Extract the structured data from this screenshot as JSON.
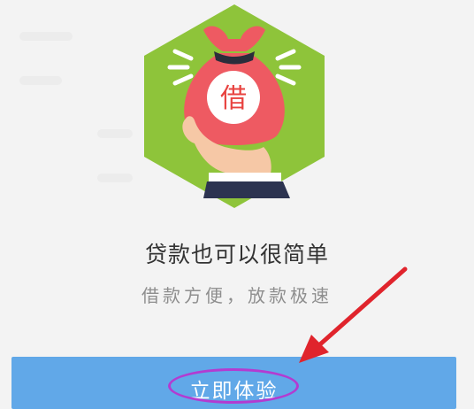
{
  "hero": {
    "icon": "money-bag-icon",
    "bag_char": "借",
    "hex_color": "#8ec43a",
    "bag_color": "#ee5a62"
  },
  "headline": "贷款也可以很简单",
  "subline": "借款方便，放款极速",
  "cta": {
    "label": "立即体验",
    "color": "#61a8e8"
  },
  "annotation": {
    "circle_color": "#b33bd1",
    "arrow_color": "#e0242c"
  }
}
